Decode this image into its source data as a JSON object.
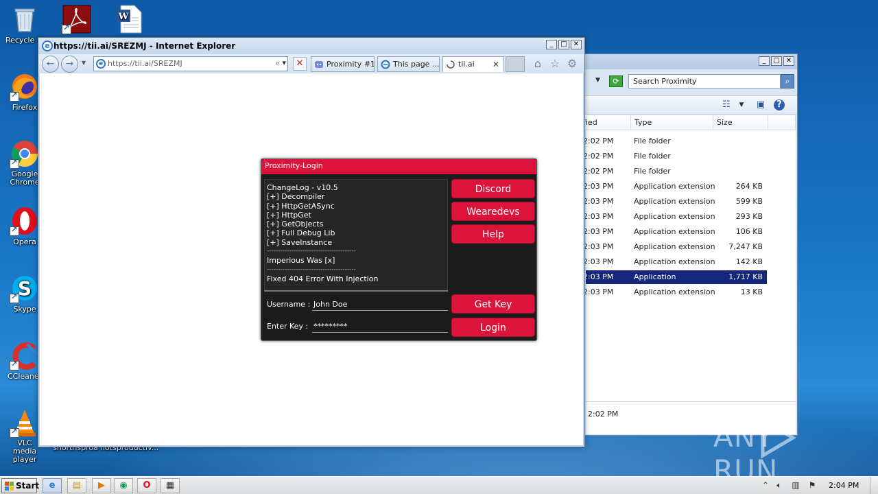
{
  "desktop": {
    "icons": [
      {
        "label": "Recycle Bin",
        "icon": "recycle-bin-icon"
      },
      {
        "label": "Firefox",
        "icon": "firefox-icon"
      },
      {
        "label": "Google Chrome",
        "icon": "chrome-icon"
      },
      {
        "label": "Opera",
        "icon": "opera-icon"
      },
      {
        "label": "Skype",
        "icon": "skype-icon"
      },
      {
        "label": "CCleaner",
        "icon": "ccleaner-icon"
      },
      {
        "label": "VLC media player",
        "icon": "vlc-icon"
      }
    ],
    "partial_labels": [
      "snortnsproa",
      "notsproductiv..."
    ]
  },
  "explorer": {
    "search_placeholder": "Search Proximity",
    "columns": {
      "modified": "fied",
      "type": "Type",
      "size": "Size"
    },
    "rows": [
      {
        "time": "2:02 PM",
        "type": "File folder",
        "size": ""
      },
      {
        "time": "2:02 PM",
        "type": "File folder",
        "size": ""
      },
      {
        "time": "2:02 PM",
        "type": "File folder",
        "size": ""
      },
      {
        "time": "2:03 PM",
        "type": "Application extension",
        "size": "264 KB"
      },
      {
        "time": "2:03 PM",
        "type": "Application extension",
        "size": "599 KB"
      },
      {
        "time": "2:03 PM",
        "type": "Application extension",
        "size": "293 KB"
      },
      {
        "time": "2:03 PM",
        "type": "Application extension",
        "size": "106 KB"
      },
      {
        "time": "2:03 PM",
        "type": "Application extension",
        "size": "7,247 KB"
      },
      {
        "time": "2:03 PM",
        "type": "Application extension",
        "size": "142 KB"
      },
      {
        "time": "2:03 PM",
        "type": "Application",
        "size": "1,717 KB",
        "selected": true
      },
      {
        "time": "2:03 PM",
        "type": "Application extension",
        "size": "13 KB"
      }
    ],
    "footer_time": "2:02 PM"
  },
  "ie": {
    "title": "https://tii.ai/SREZMJ - Internet Explorer",
    "address": "https://tii.ai/SREZMJ",
    "tabs": [
      {
        "label": "Proximity #1",
        "icon": "discord-icon"
      },
      {
        "label": "This page ...",
        "icon": "ie-icon"
      },
      {
        "label": "tii.ai",
        "icon": "loading-icon",
        "active": true
      }
    ]
  },
  "proximity": {
    "header": "Proximity-Login",
    "changelog": {
      "title": "ChangeLog - v10.5",
      "items": [
        "[+] Decompiler",
        "[+] HttpGetASync",
        "[+] HttpGet",
        "[+] GetObjects",
        "[+] Full Debug Lib",
        "[+] SaveInstance"
      ],
      "separator": "----------------------------------------",
      "note1": "Imperious Was [x]",
      "separator2": "----------------------------------------",
      "note2": "Fixed 404 Error With Injection"
    },
    "buttons": {
      "discord": "Discord",
      "wearedevs": "Wearedevs",
      "help": "Help",
      "getkey": "Get Key",
      "login": "Login"
    },
    "username_label": "Username :",
    "username_value": "John Doe",
    "key_label": "Enter Key :",
    "key_value": "*********",
    "colors": {
      "accent": "#dc143c",
      "panel": "#1c1c1c"
    }
  },
  "taskbar": {
    "start_label": "Start",
    "clock": "2:04 PM"
  },
  "watermark": {
    "left": "ANY",
    "right": "RUN"
  }
}
